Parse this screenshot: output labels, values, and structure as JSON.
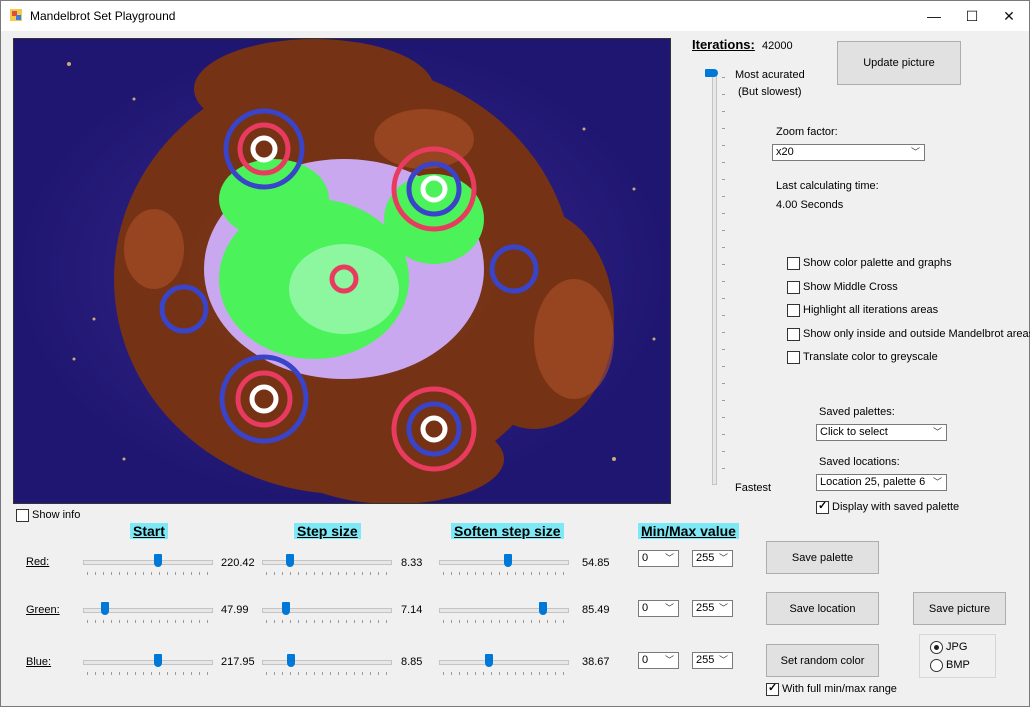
{
  "window": {
    "title": "Mandelbrot Set Playground"
  },
  "titlebar": {
    "minimize": "—",
    "maximize": "☐",
    "close": "✕"
  },
  "iterations": {
    "label": "Iterations:",
    "value": "42000",
    "top_label": "Most acurated",
    "top_sublabel": "(But slowest)",
    "bottom_label": "Fastest",
    "slider_fraction": 1.0
  },
  "buttons": {
    "update": "Update picture",
    "save_palette": "Save  palette",
    "save_location": "Save location",
    "save_picture": "Save picture",
    "random_color": "Set random color"
  },
  "zoom": {
    "label": "Zoom factor:",
    "value": "x20"
  },
  "calc": {
    "label": "Last calculating time:",
    "value": "4.00 Seconds"
  },
  "options": [
    {
      "label": "Show color palette and graphs",
      "checked": false
    },
    {
      "label": "Show Middle Cross",
      "checked": false
    },
    {
      "label": "Highlight all iterations areas",
      "checked": false
    },
    {
      "label": "Show only inside and outside Mandelbrot areas",
      "checked": false
    },
    {
      "label": "Translate color to greyscale",
      "checked": false
    }
  ],
  "saved_palettes": {
    "label": "Saved palettes:",
    "value": "Click to select"
  },
  "saved_locations": {
    "label": "Saved locations:",
    "value": "Location 25, palette 6"
  },
  "display_saved_palette": {
    "label": "Display with saved palette",
    "checked": true
  },
  "show_info": {
    "label": "Show info",
    "checked": false
  },
  "headers": {
    "start": "Start",
    "step": "Step size",
    "soften": "Soften step size",
    "minmax": "Min/Max value"
  },
  "channels": [
    {
      "name": "Red:",
      "start": "220.42",
      "start_frac": 0.59,
      "step": "8.33",
      "step_frac": 0.2,
      "soften": "54.85",
      "soften_frac": 0.54,
      "min": "0",
      "max": "255"
    },
    {
      "name": "Green:",
      "start": "47.99",
      "start_frac": 0.15,
      "step": "7.14",
      "step_frac": 0.17,
      "soften": "85.49",
      "soften_frac": 0.83,
      "min": "0",
      "max": "255"
    },
    {
      "name": "Blue:",
      "start": "217.95",
      "start_frac": 0.59,
      "step": "8.85",
      "step_frac": 0.21,
      "soften": "38.67",
      "soften_frac": 0.38,
      "min": "0",
      "max": "255"
    }
  ],
  "full_range": {
    "label": "With full min/max range",
    "checked": true
  },
  "format": {
    "jpg": "JPG",
    "bmp": "BMP",
    "selected": "JPG"
  },
  "colors": {
    "background": "#23197a",
    "outer": "#7a3410",
    "green": "#4cf25a",
    "lavender": "#c9a8f0",
    "accent": "#7de9f7",
    "slider": "#0078d7"
  }
}
